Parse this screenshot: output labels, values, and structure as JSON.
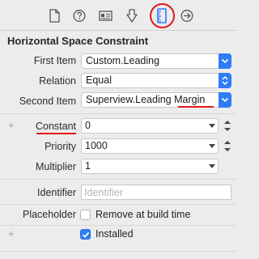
{
  "toolbar": {
    "icons": [
      "file-icon",
      "help-icon",
      "identity-icon",
      "attributes-icon",
      "size-ruler-icon",
      "connections-icon"
    ],
    "selected": "size-ruler-icon",
    "accent": "#2f7cf6",
    "highlight_color": "#e11919"
  },
  "section": {
    "title": "Horizontal Space Constraint"
  },
  "fields": {
    "first_item": {
      "label": "First Item",
      "value": "Custom.Leading"
    },
    "relation": {
      "label": "Relation",
      "value": "Equal"
    },
    "second_item": {
      "label": "Second Item",
      "value": "Superview.Leading Margin"
    },
    "constant": {
      "label": "Constant",
      "value": "0"
    },
    "priority": {
      "label": "Priority",
      "value": "1000"
    },
    "multiplier": {
      "label": "Multiplier",
      "value": "1"
    },
    "identifier": {
      "label": "Identifier",
      "placeholder": "Identifier",
      "value": ""
    },
    "placeholder": {
      "label": "Placeholder",
      "checkbox_label": "Remove at build time",
      "checked": false
    },
    "installed": {
      "checkbox_label": "Installed",
      "checked": true
    }
  }
}
